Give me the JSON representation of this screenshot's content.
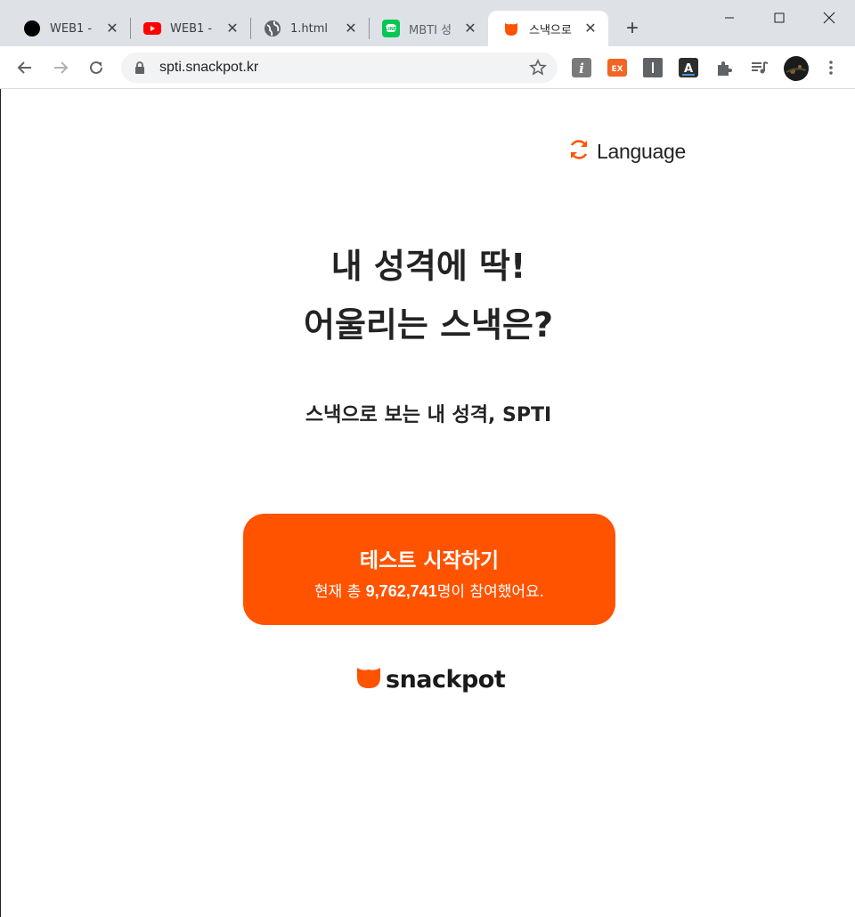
{
  "browser": {
    "tabs": [
      {
        "title": "WEB1 -",
        "icon": "black-circle-icon"
      },
      {
        "title": "WEB1 -",
        "icon": "youtube-icon"
      },
      {
        "title": "1.html",
        "icon": "globe-icon"
      },
      {
        "title": "MBTI 성",
        "icon": "line-app-icon"
      },
      {
        "title": "스낵으로",
        "icon": "snackpot-icon"
      }
    ],
    "active_tab": 4,
    "url": "spti.snackpot.kr",
    "extensions": [
      "info-extension-icon",
      "ex-extension-icon",
      "bar-extension-icon",
      "font-extension-icon",
      "puzzle-extensions-icon",
      "media-control-icon",
      "profile-avatar"
    ]
  },
  "page": {
    "language_label": "Language",
    "title_line1": "내 성격에 딱!",
    "title_line2": "어울리는 스낵은?",
    "subtitle": "스낵으로 보는 내 성격, SPTI",
    "cta": {
      "label": "테스트 시작하기",
      "count_prefix": "현재 총 ",
      "count": "9,762,741",
      "count_suffix": "명이 참여했어요."
    },
    "brand": "snackpot"
  },
  "colors": {
    "accent": "#ff5300",
    "tabstrip": "#dee1e6",
    "omnibox": "#f1f3f4",
    "text": "#232323"
  }
}
